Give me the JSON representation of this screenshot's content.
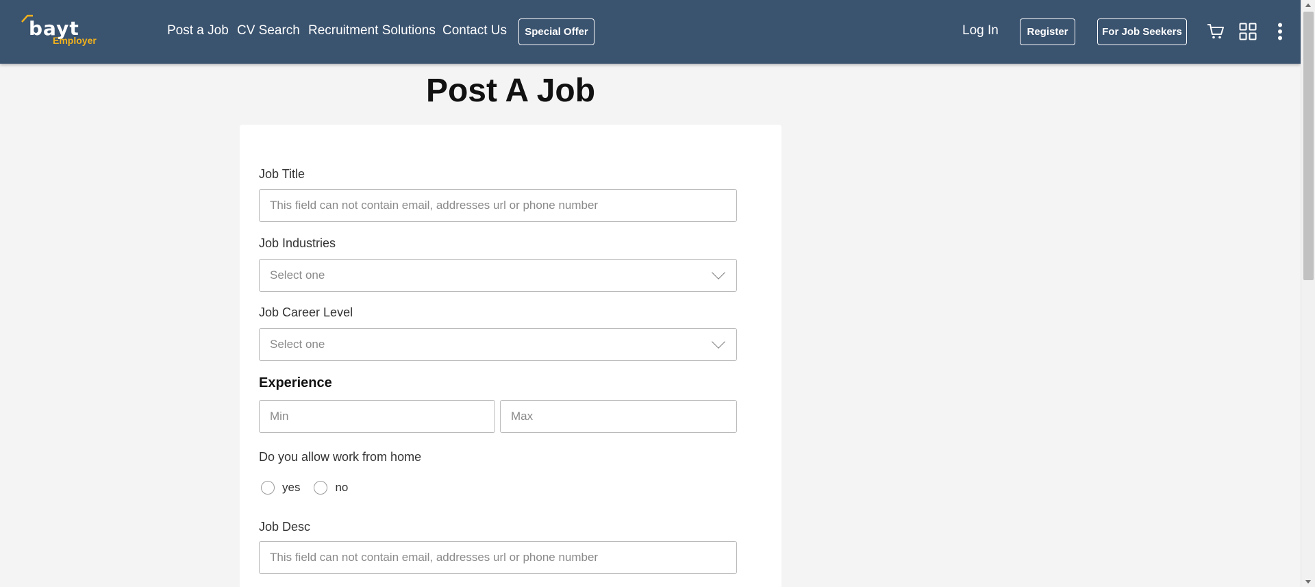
{
  "header": {
    "logo_text": "bayt",
    "logo_sub": "Employer",
    "nav": [
      {
        "label": "Post a Job"
      },
      {
        "label": "CV Search"
      },
      {
        "label": "Recruitment Solutions"
      },
      {
        "label": "Contact Us"
      }
    ],
    "special_offer": "Special Offer",
    "login": "Log In",
    "register": "Register",
    "job_seekers": "For Job Seekers",
    "icons": [
      "cart-icon",
      "apps-grid-icon",
      "more-vertical-icon"
    ]
  },
  "page": {
    "title": "Post A Job"
  },
  "form": {
    "job_title": {
      "label": "Job Title",
      "placeholder": "This field can not contain email, addresses url or phone number",
      "value": ""
    },
    "job_industries": {
      "label": "Job Industries",
      "selected": "Select one"
    },
    "job_career_level": {
      "label": "Job Career Level",
      "selected": "Select one"
    },
    "experience": {
      "title": "Experience",
      "min_placeholder": "Min",
      "max_placeholder": "Max"
    },
    "work_from_home": {
      "label": "Do you allow work from home",
      "options": [
        "yes",
        "no"
      ]
    },
    "job_desc": {
      "label": "Job Desc",
      "placeholder": "This field can not contain email, addresses url or phone number",
      "value": ""
    }
  },
  "colors": {
    "header_bg": "#3a536f",
    "logo_accent": "#f2b21c",
    "page_bg": "#f4f4f4"
  }
}
